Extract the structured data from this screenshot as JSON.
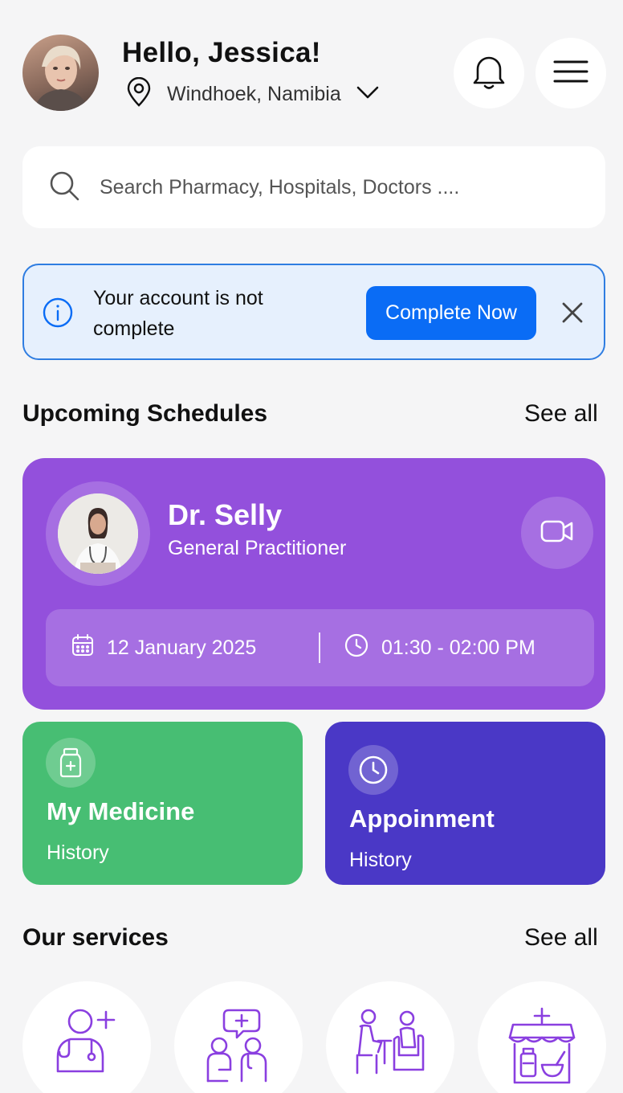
{
  "header": {
    "greeting": "Hello, Jessica!",
    "location": "Windhoek, Namibia"
  },
  "search": {
    "placeholder": "Search Pharmacy, Hospitals, Doctors ...."
  },
  "alert": {
    "message": "Your account is not complete",
    "action_label": "Complete Now",
    "accent_color": "#0a6cf5"
  },
  "schedules": {
    "title": "Upcoming Schedules",
    "see_all": "See all",
    "card": {
      "doctor_name": "Dr. Selly",
      "specialty": "General Practitioner",
      "date": "12 January 2025",
      "time": "01:30 - 02:00 PM",
      "color": "#9350dc"
    }
  },
  "history_cards": {
    "medicine": {
      "title": "My Medicine",
      "subtitle": "History",
      "color": "#47be73"
    },
    "appointment": {
      "title": "Appoinment",
      "subtitle": "History",
      "color": "#4a38c6"
    }
  },
  "services": {
    "title": "Our services",
    "see_all": "See all",
    "items": [
      {
        "icon": "add-doctor-icon"
      },
      {
        "icon": "consultation-icon"
      },
      {
        "icon": "counseling-icon"
      },
      {
        "icon": "pharmacy-icon"
      }
    ],
    "icon_color": "#8a3fe0"
  }
}
